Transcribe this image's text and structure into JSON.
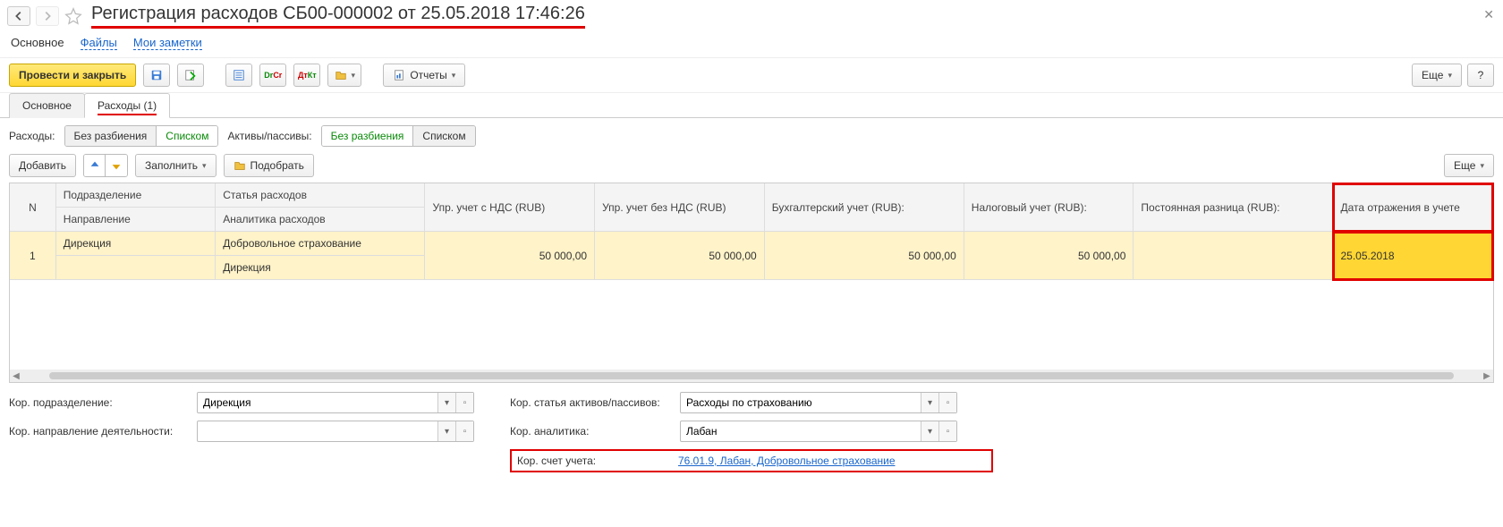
{
  "header": {
    "title": "Регистрация расходов СБ00-000002 от 25.05.2018 17:46:26"
  },
  "link_tabs": {
    "main": "Основное",
    "files": "Файлы",
    "notes": "Мои заметки"
  },
  "toolbar": {
    "post_and_close": "Провести и закрыть",
    "reports": "Отчеты",
    "more": "Еще"
  },
  "page_tabs": {
    "main": "Основное",
    "expenses": "Расходы (1)"
  },
  "segments": {
    "expenses_label": "Расходы:",
    "assets_label": "Активы/пассивы:",
    "no_split": "Без разбиения",
    "list": "Списком"
  },
  "row_toolbar": {
    "add": "Добавить",
    "fill": "Заполнить",
    "pick": "Подобрать",
    "more": "Еще"
  },
  "columns": {
    "n": "N",
    "department": "Подразделение",
    "direction": "Направление",
    "expense_item": "Статья расходов",
    "expense_analytics": "Аналитика расходов",
    "mgmt_vat": "Упр. учет с НДС (RUB)",
    "mgmt_novat": "Упр. учет без НДС (RUB)",
    "bookkeeping": "Бухгалтерский учет (RUB):",
    "tax": "Налоговый учет (RUB):",
    "perm_diff": "Постоянная разница (RUB):",
    "reflection_date": "Дата отражения в учете"
  },
  "row": {
    "n": "1",
    "department": "Дирекция",
    "expense_item": "Добровольное страхование",
    "direction": "",
    "expense_analytics": "Дирекция",
    "mgmt_vat": "50 000,00",
    "mgmt_novat": "50 000,00",
    "bookkeeping": "50 000,00",
    "tax": "50 000,00",
    "perm_diff": "",
    "reflection_date": "25.05.2018"
  },
  "form": {
    "corr_department_label": "Кор. подразделение:",
    "corr_department_value": "Дирекция",
    "corr_activity_label": "Кор. направление деятельности:",
    "corr_activity_value": "",
    "corr_asset_item_label": "Кор. статья активов/пассивов:",
    "corr_asset_item_value": "Расходы по страхованию",
    "corr_analytics_label": "Кор. аналитика:",
    "corr_analytics_value": "Лабан",
    "corr_account_label": "Кор. счет учета:",
    "corr_account_link": "76.01.9, Лабан, Добровольное страхование"
  }
}
